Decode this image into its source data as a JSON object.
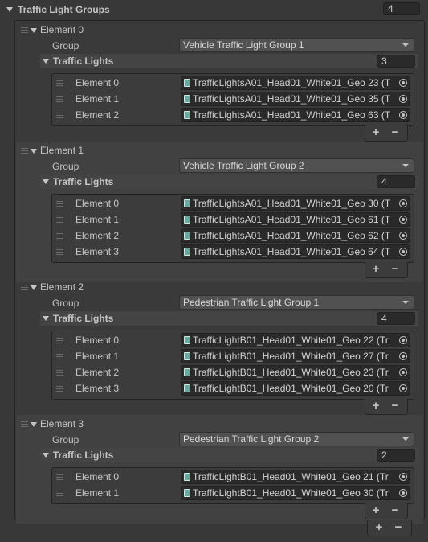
{
  "inspector": {
    "title": "Traffic Light Groups",
    "group_count": "4",
    "group_label": "Group",
    "traffic_lights_label": "Traffic Lights",
    "plus": "+",
    "minus": "−",
    "groups": [
      {
        "name": "Element 0",
        "group_value": "Vehicle Traffic Light Group 1",
        "count": "3",
        "lights": [
          {
            "name": "Element 0",
            "value": "TrafficLightsA01_Head01_White01_Geo 23 (T"
          },
          {
            "name": "Element 1",
            "value": "TrafficLightsA01_Head01_White01_Geo 35 (T"
          },
          {
            "name": "Element 2",
            "value": "TrafficLightsA01_Head01_White01_Geo 63 (T"
          }
        ]
      },
      {
        "name": "Element 1",
        "group_value": "Vehicle Traffic Light Group 2",
        "count": "4",
        "lights": [
          {
            "name": "Element 0",
            "value": "TrafficLightsA01_Head01_White01_Geo 30 (T"
          },
          {
            "name": "Element 1",
            "value": "TrafficLightsA01_Head01_White01_Geo 61 (T"
          },
          {
            "name": "Element 2",
            "value": "TrafficLightsA01_Head01_White01_Geo 62 (T"
          },
          {
            "name": "Element 3",
            "value": "TrafficLightsA01_Head01_White01_Geo 64 (T"
          }
        ]
      },
      {
        "name": "Element 2",
        "group_value": "Pedestrian Traffic Light Group 1",
        "count": "4",
        "lights": [
          {
            "name": "Element 0",
            "value": "TrafficLightB01_Head01_White01_Geo 22 (Tr"
          },
          {
            "name": "Element 1",
            "value": "TrafficLightB01_Head01_White01_Geo 27 (Tr"
          },
          {
            "name": "Element 2",
            "value": "TrafficLightB01_Head01_White01_Geo 23 (Tr"
          },
          {
            "name": "Element 3",
            "value": "TrafficLightB01_Head01_White01_Geo 20 (Tr"
          }
        ]
      },
      {
        "name": "Element 3",
        "group_value": "Pedestrian Traffic Light Group 2",
        "count": "2",
        "lights": [
          {
            "name": "Element 0",
            "value": "TrafficLightB01_Head01_White01_Geo 21 (Tr"
          },
          {
            "name": "Element 1",
            "value": "TrafficLightB01_Head01_White01_Geo 30 (Tr"
          }
        ]
      }
    ]
  }
}
